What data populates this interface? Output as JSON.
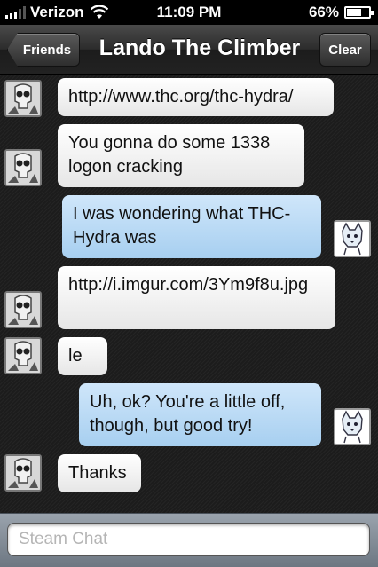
{
  "status": {
    "carrier": "Verizon",
    "time": "11:09 PM",
    "battery": "66%",
    "battery_level": 0.66,
    "icons": [
      "signal-icon",
      "wifi-icon",
      "battery-icon"
    ]
  },
  "nav": {
    "back_label": "Friends",
    "title": "Lando The Climber",
    "clear_label": "Clear"
  },
  "messages": [
    {
      "from": "friend",
      "text": "http://www.thc.org/thc-hydra/"
    },
    {
      "from": "friend",
      "text": "You gonna do some 1338 logon cracking"
    },
    {
      "from": "me",
      "text": "I was wondering what THC-Hydra was"
    },
    {
      "from": "friend",
      "text": "http://i.imgur.com/3Ym9f8u.jpg"
    },
    {
      "from": "friend",
      "text": "le"
    },
    {
      "from": "me",
      "text": "Uh, ok? You're a little off, though, but good try!"
    },
    {
      "from": "friend",
      "text": "Thanks"
    }
  ],
  "input": {
    "placeholder": "Steam Chat",
    "value": ""
  },
  "colors": {
    "incoming_bubble": "#ffffff",
    "outgoing_bubble": "#b9dbf5",
    "navbar": "#2c2c2c"
  }
}
